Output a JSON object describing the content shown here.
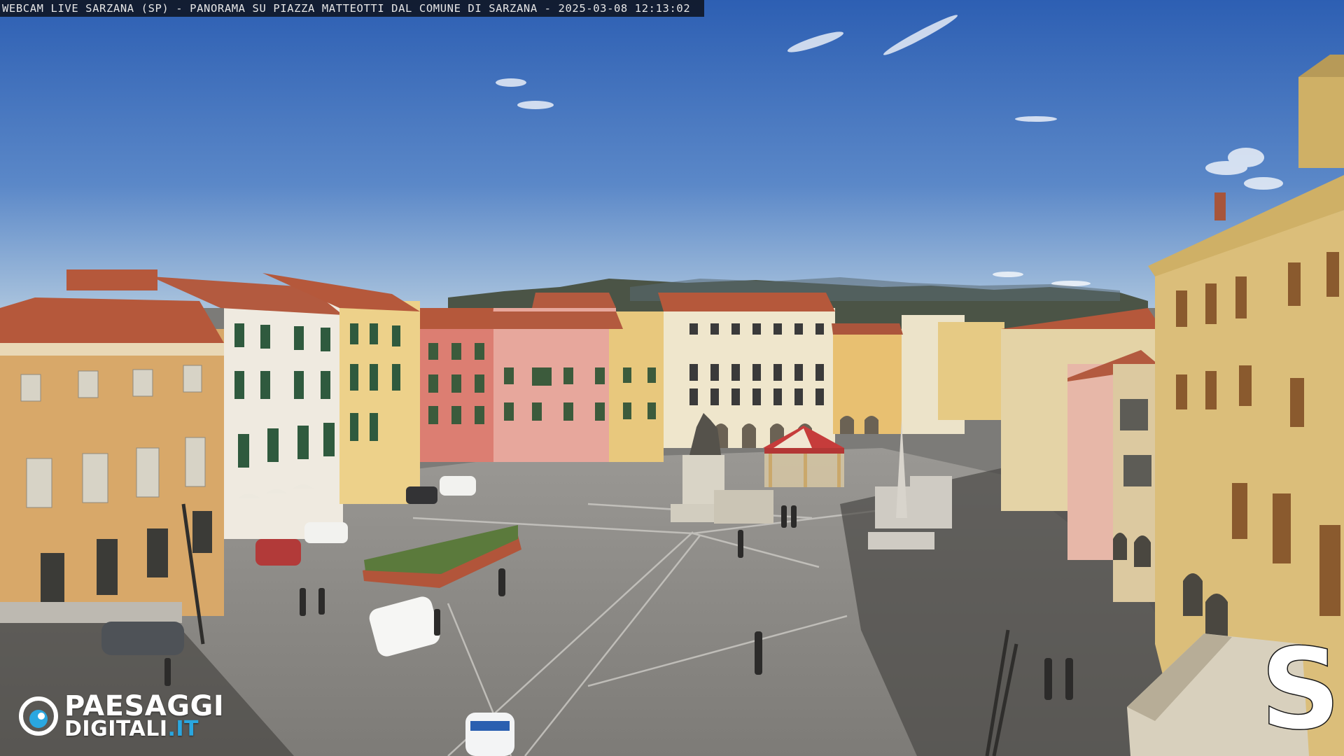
{
  "caption": {
    "text": "WEBCAM LIVE SARZANA (SP) - PANORAMA SU PIAZZA MATTEOTTI DAL COMUNE DI SARZANA - 2025-03-08  12:13:02"
  },
  "logo": {
    "line1": "PAESAGGI",
    "line2_main": "DIGITALI",
    "line2_suffix": ".IT",
    "accent_color": "#2aa7e0"
  },
  "watermark": {
    "letter": "S"
  },
  "colors": {
    "sky_top": "#2f63b6",
    "sky_bottom": "#a9c3dd",
    "pavement": "#8a8884",
    "roof": "#b5583b"
  }
}
